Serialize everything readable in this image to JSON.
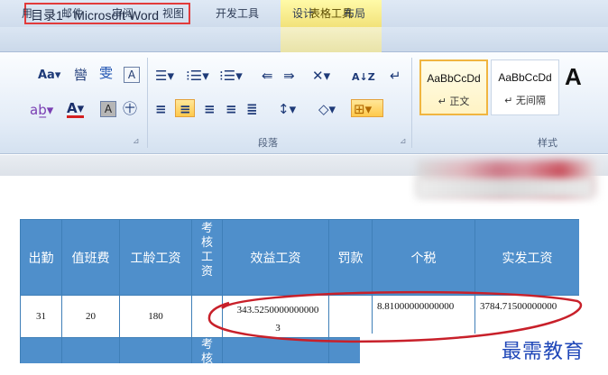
{
  "window": {
    "title": "目录1 - Microsoft Word",
    "context_tab_group": "表格工具"
  },
  "tabs": [
    "用",
    "邮件",
    "审阅",
    "视图",
    "开发工具",
    "设计",
    "布局"
  ],
  "ribbon": {
    "font_group_glyphs": {
      "grow_shrink": "Aa▾",
      "phonetic": "㘘",
      "enclose_char": "雯",
      "char_border": "A",
      "highlight": "ab̲▾",
      "font_color": "A▾",
      "char_shading": "A",
      "enclosed": "㊉"
    },
    "paragraph_group": {
      "label": "段落",
      "bullets": "☰▾",
      "numbering": "⁝☰▾",
      "multilevel": "⁝☰▾",
      "decrease_indent": "⇚",
      "increase_indent": "⇛",
      "chinese_layout": "✕▾",
      "sort": "A↓Z",
      "show_marks": "↵",
      "align_left": "≡",
      "align_center": "≡",
      "align_right": "≡",
      "justify": "≡",
      "distributed": "≣",
      "line_spacing": "↕▾",
      "shading": "◇▾",
      "borders": "⊞▾"
    },
    "styles_group": {
      "label": "样式",
      "styles": [
        {
          "sample": "AaBbCcDd",
          "name": "↵ 正文",
          "selected": true
        },
        {
          "sample": "AaBbCcDd",
          "name": "↵ 无间隔",
          "selected": false
        }
      ],
      "big_sample": "A"
    },
    "launcher_glyph": "⊿"
  },
  "table": {
    "headers": [
      "出勤",
      "值班费",
      "工龄工资",
      "考核工资",
      "效益工资",
      "罚款",
      "个税",
      "实发工资"
    ],
    "narrow_header_chars": [
      "考",
      "核",
      "工",
      "资"
    ],
    "row": [
      "31",
      "20",
      "180",
      "",
      "343.5250000000000\n3",
      "",
      "8.81000000000000",
      "3784.71500000000"
    ],
    "next_row_chars": [
      "考",
      "核"
    ]
  },
  "watermark": "最需教育",
  "colors": {
    "title_highlight": "#e23b3b",
    "table_header": "#4f8fcb",
    "annotation_oval": "#c8202a",
    "watermark": "#1f47b8"
  }
}
